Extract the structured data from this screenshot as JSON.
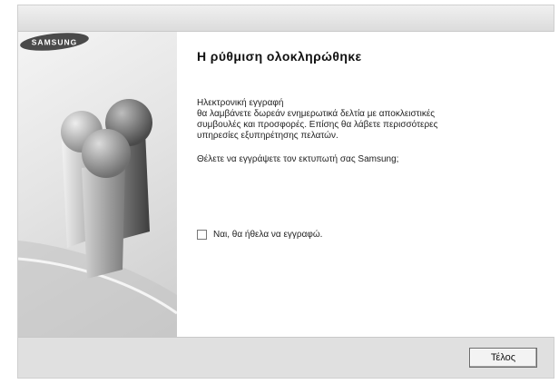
{
  "dialog": {
    "heading": "Η ρύθμιση ολοκληρώθηκε",
    "paragraph_lines": [
      "Ηλεκτρονική εγγραφή",
      "θα λαμβάνετε δωρεάν ενημερωτικά δελτία με αποκλειστικές",
      "συμβουλές και προσφορές. Επίσης θα λάβετε περισσότερες",
      "υπηρεσίες εξυπηρέτησης πελατών."
    ],
    "question": "Θέλετε να εγγράψετε τον εκτυπωτή σας Samsung;",
    "checkbox": {
      "label": "Ναι, θα ήθελα να εγγραφώ.",
      "checked": false
    },
    "finish_button_label": "Τέλος"
  },
  "sidebar": {
    "brand_logo": "SAMSUNG"
  }
}
